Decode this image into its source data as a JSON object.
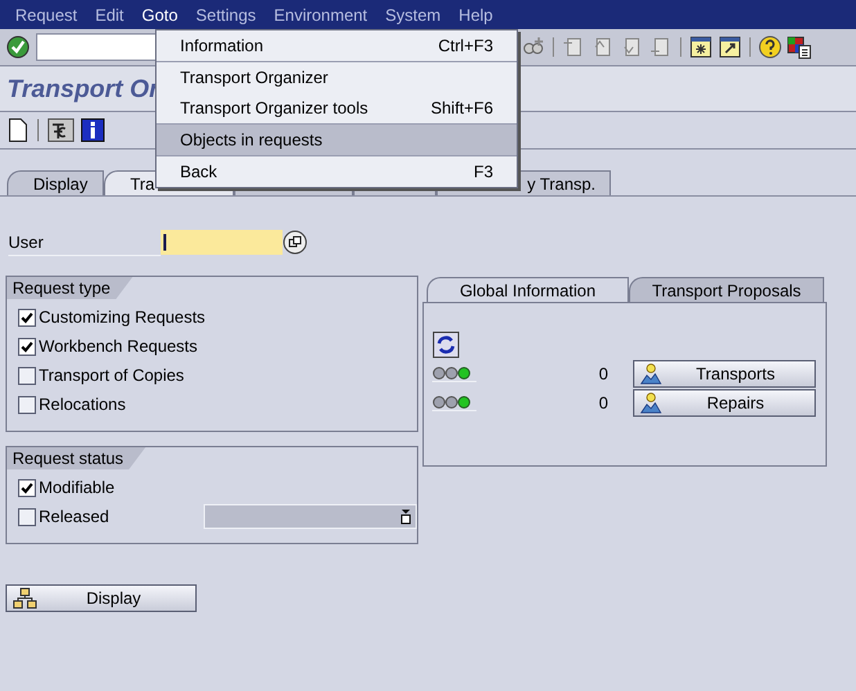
{
  "menu_bar": [
    {
      "label": "Request",
      "selected": false
    },
    {
      "label": "Edit",
      "selected": false
    },
    {
      "label": "Goto",
      "selected": true
    },
    {
      "label": "Settings",
      "selected": false
    },
    {
      "label": "Environment",
      "selected": false
    },
    {
      "label": "System",
      "selected": false
    },
    {
      "label": "Help",
      "selected": false
    }
  ],
  "dropdown": {
    "groups": [
      [
        {
          "label": "Information",
          "shortcut": "Ctrl+F3",
          "selected": false
        }
      ],
      [
        {
          "label": "Transport Organizer",
          "selected": false
        },
        {
          "label": "Transport Organizer tools",
          "shortcut": "Shift+F6",
          "selected": false
        }
      ],
      [
        {
          "label": "Objects in requests",
          "selected": true
        }
      ],
      [
        {
          "label": "Back",
          "shortcut": "F3",
          "selected": false
        }
      ]
    ]
  },
  "title": "Transport Or",
  "tabs": [
    {
      "label": "Display",
      "selected": false
    },
    {
      "label": "Tra",
      "selected": true
    },
    {
      "selected": false
    },
    {
      "selected": false
    },
    {
      "label": "y Transp.",
      "selected": false
    }
  ],
  "user": {
    "label": "User"
  },
  "request_type": {
    "title": "Request type",
    "options": [
      {
        "label": "Customizing Requests",
        "checked": true
      },
      {
        "label": "Workbench Requests",
        "checked": true
      },
      {
        "label": "Transport of Copies",
        "checked": false
      },
      {
        "label": "Relocations",
        "checked": false
      }
    ]
  },
  "request_status": {
    "title": "Request status",
    "options": [
      {
        "label": "Modifiable",
        "checked": true
      },
      {
        "label": "Released",
        "checked": false
      }
    ]
  },
  "info_tabs": [
    {
      "label": "Global Information",
      "selected": true
    },
    {
      "label": "Transport Proposals",
      "selected": false
    }
  ],
  "info_rows": [
    {
      "count": "0",
      "button": "Transports"
    },
    {
      "count": "0",
      "button": "Repairs"
    }
  ],
  "display_button": "Display"
}
